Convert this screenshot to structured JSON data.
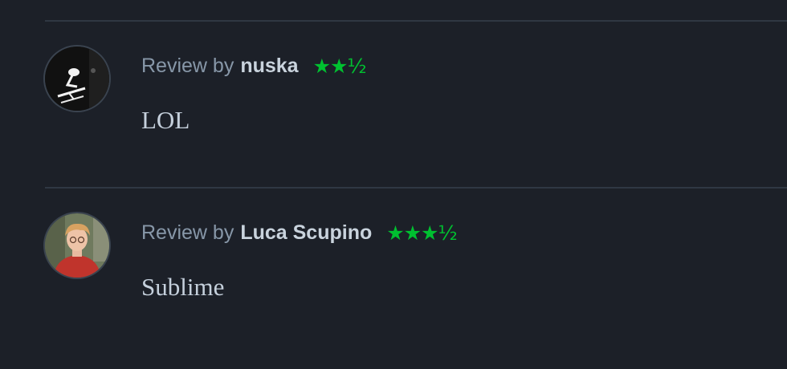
{
  "reviews": [
    {
      "prefix": "Review by",
      "author": "nuska",
      "rating": 2.5,
      "stars_text": "★★½",
      "body": "LOL",
      "avatar_icon": "abstract-black-white-avatar"
    },
    {
      "prefix": "Review by",
      "author": "Luca Scupino",
      "rating": 3.5,
      "stars_text": "★★★½",
      "body": "Sublime",
      "avatar_icon": "person-red-shirt-avatar"
    }
  ],
  "colors": {
    "background": "#1c2028",
    "divider": "#2f3743",
    "star": "#00c030",
    "author": "#c9d3dd",
    "meta": "#8797a8",
    "body": "#c5d0dc"
  }
}
